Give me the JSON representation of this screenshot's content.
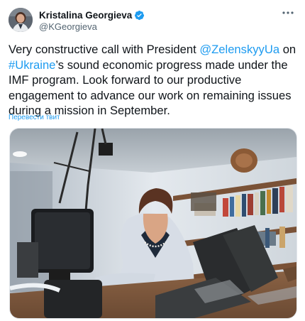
{
  "author": {
    "display_name": "Kristalina Georgieva",
    "handle": "@KGeorgieva",
    "verified_icon": "verified-badge-icon"
  },
  "tweet": {
    "text_1": "Very constructive call with President ",
    "mention": "@ZelenskyyUa",
    "text_2": " on ",
    "hashtag": "#Ukraine",
    "text_3": "’s sound economic progress made under the IMF program. Look forward to our productive engagement to advance our work on remaining issues during a mission in September.",
    "translate_label": "Перевести твит"
  },
  "colors": {
    "link": "#1d9bf0",
    "text": "#0f1419",
    "secondary": "#536471"
  }
}
